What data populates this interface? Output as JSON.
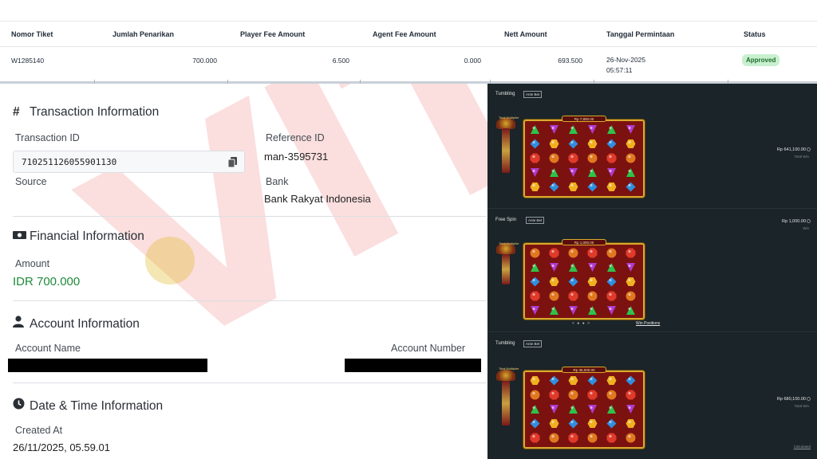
{
  "ticket_table": {
    "headers": {
      "ticket_no": "Nomor Tiket",
      "withdraw_amount": "Jumlah Penarikan",
      "player_fee": "Player Fee Amount",
      "agent_fee": "Agent Fee Amount",
      "nett": "Nett Amount",
      "request_date": "Tanggal Permintaan",
      "status": "Status"
    },
    "row": {
      "ticket_no": "W1285140",
      "withdraw_amount": "700.000",
      "player_fee": "6.500",
      "agent_fee": "0.000",
      "nett": "693.500",
      "request_date_line1": "26-Nov-2025",
      "request_date_line2": "05:57:11",
      "status": "Approved"
    },
    "status_color": "#c8f0cf"
  },
  "transaction_info": {
    "title": "Transaction Information",
    "transaction_id_label": "Transaction ID",
    "transaction_id": "710251126055901130",
    "reference_id_label": "Reference ID",
    "reference_id": "man-3595731",
    "source_label": "Source",
    "bank_label": "Bank",
    "bank": "Bank Rakyat Indonesia"
  },
  "financial_info": {
    "title": "Financial Information",
    "amount_label": "Amount",
    "amount": "IDR 700.000",
    "amount_color": "#1e8a3a"
  },
  "account_info": {
    "title": "Account Information",
    "account_name_label": "Account Name",
    "account_number_label": "Account Number"
  },
  "datetime_info": {
    "title": "Date & Time Information",
    "created_at_label": "Created At",
    "created_at": "26/11/2025, 05.59.01"
  },
  "watermark": {
    "text": "VIT",
    "right_text": "8"
  },
  "game_panels": [
    {
      "mode": "Tumbling",
      "tag": "Ante Bet",
      "multiplier_label": "Total Multiplier",
      "board_price": "Rp 7,800.00",
      "win_amount": "Rp 641,100.00",
      "win_sub": "Total Win"
    },
    {
      "mode": "Free Spin",
      "tag": "Ante Bet",
      "multiplier_label": "Total Multiplier",
      "board_price": "Rp 1,000.00",
      "win_amount": "Rp 1,000.00",
      "win_sub": "Win",
      "win_positions_link": "Win Positions"
    },
    {
      "mode": "Tumbling",
      "tag": "Ante Bet",
      "multiplier_label": "Total Multiplier",
      "board_price": "Rp 35,000.00",
      "win_amount": "Rp 680,100.00",
      "win_sub": "Total Win",
      "calculated_link": "Calculated"
    }
  ],
  "colors": {
    "game_bg": "#1b2428",
    "board_red": "#7b1210",
    "board_gold": "#d9a92d"
  }
}
